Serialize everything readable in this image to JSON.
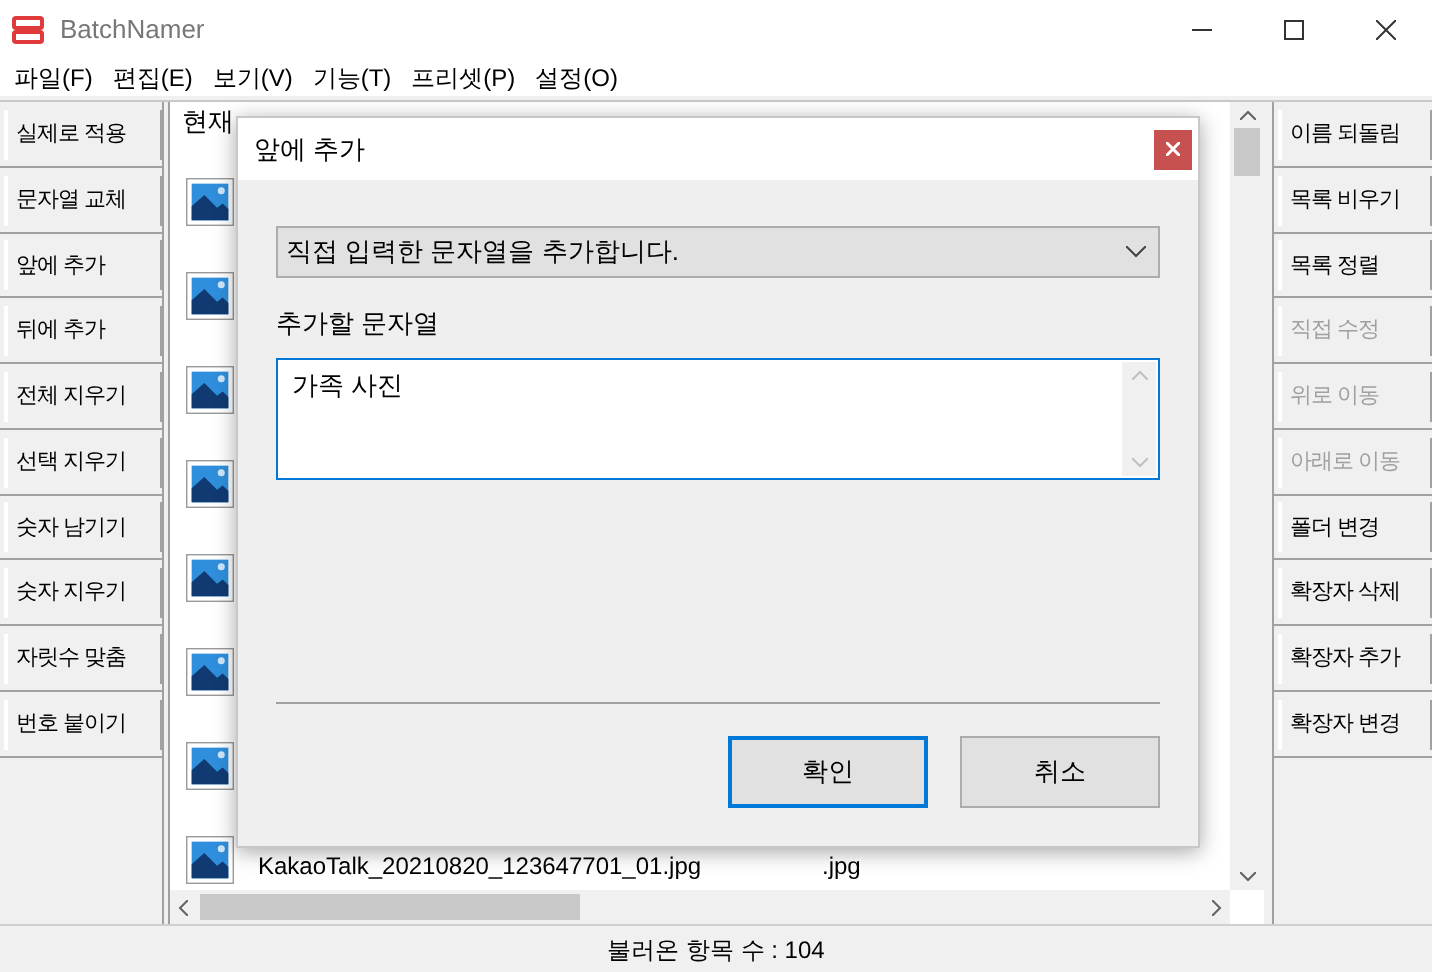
{
  "window": {
    "title": "BatchNamer"
  },
  "menu": [
    "파일(F)",
    "편집(E)",
    "보기(V)",
    "기능(T)",
    "프리셋(P)",
    "설정(O)"
  ],
  "left_buttons": [
    {
      "label": "실제로 적용",
      "disabled": false
    },
    {
      "label": "문자열 교체",
      "disabled": false
    },
    {
      "label": "앞에 추가",
      "disabled": false
    },
    {
      "label": "뒤에 추가",
      "disabled": false
    },
    {
      "label": "전체 지우기",
      "disabled": false
    },
    {
      "label": "선택 지우기",
      "disabled": false
    },
    {
      "label": "숫자 남기기",
      "disabled": false
    },
    {
      "label": "숫자 지우기",
      "disabled": false
    },
    {
      "label": "자릿수 맞춤",
      "disabled": false
    },
    {
      "label": "번호 붙이기",
      "disabled": false
    }
  ],
  "table": {
    "columns": [
      "현재"
    ],
    "rows": [
      {},
      {},
      {},
      {},
      {},
      {},
      {},
      {
        "name": "KakaoTalk_20210820_123647701_01.jpg",
        "ext": ".jpg"
      }
    ]
  },
  "right_buttons": [
    {
      "label": "이름 되돌림",
      "disabled": false
    },
    {
      "label": "목록 비우기",
      "disabled": false
    },
    {
      "label": "목록 정렬",
      "disabled": false
    },
    {
      "label": "직접 수정",
      "disabled": true
    },
    {
      "label": "위로 이동",
      "disabled": true
    },
    {
      "label": "아래로 이동",
      "disabled": true
    },
    {
      "label": "폴더 변경",
      "disabled": false
    },
    {
      "label": "확장자 삭제",
      "disabled": false
    },
    {
      "label": "확장자 추가",
      "disabled": false
    },
    {
      "label": "확장자 변경",
      "disabled": false
    }
  ],
  "status_bar": "불러온 항목 수 : 104",
  "dialog": {
    "title": "앞에 추가",
    "mode": "직접 입력한 문자열을 추가합니다.",
    "field_label": "추가할 문자열",
    "value": "가족 사진",
    "buttons": [
      {
        "label": "확인",
        "selected": true
      },
      {
        "label": "취소",
        "selected": false
      }
    ]
  }
}
